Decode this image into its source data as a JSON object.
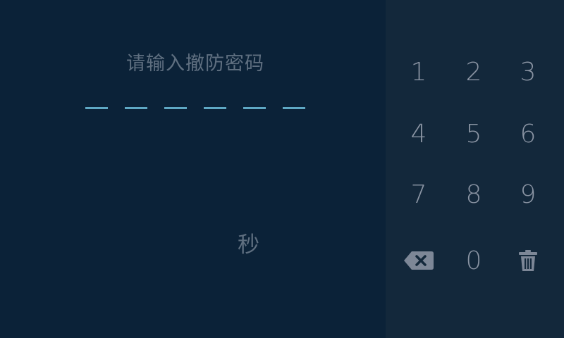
{
  "prompt": "请输入撤防密码",
  "pin": {
    "length": 6,
    "entered": 0
  },
  "countdown": {
    "value": "",
    "unit": "秒"
  },
  "keypad": {
    "keys": [
      "1",
      "2",
      "3",
      "4",
      "5",
      "6",
      "7",
      "8",
      "9"
    ],
    "zero": "0",
    "backspace_icon": "backspace-icon",
    "clear_icon": "trash-icon"
  },
  "colors": {
    "left_background": "#0b2238",
    "right_background": "#13283b",
    "text": "#5f6f80",
    "key_text": "#8a94a3",
    "pin_underline": "#5fa8c4",
    "icon": "#7d8797"
  }
}
